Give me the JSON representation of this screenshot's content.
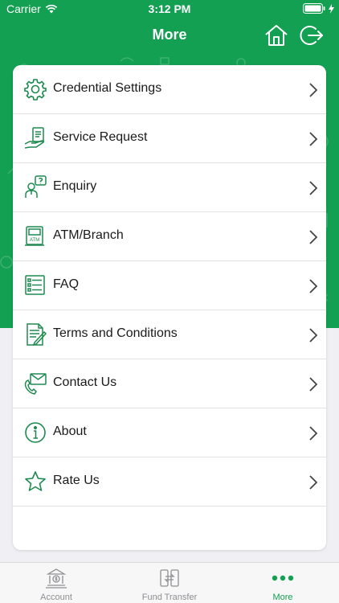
{
  "status_bar": {
    "carrier": "Carrier",
    "time": "3:12 PM"
  },
  "header": {
    "title": "More",
    "home_icon": "home-icon",
    "logout_icon": "logout-icon"
  },
  "colors": {
    "brand_green": "#13a052",
    "icon_green": "#1e8a50"
  },
  "menu": {
    "items": [
      {
        "label": "Credential Settings",
        "icon": "gear-icon"
      },
      {
        "label": "Service Request",
        "icon": "service-request-icon"
      },
      {
        "label": "Enquiry",
        "icon": "enquiry-icon"
      },
      {
        "label": "ATM/Branch",
        "icon": "atm-icon"
      },
      {
        "label": "FAQ",
        "icon": "faq-icon"
      },
      {
        "label": "Terms and Conditions",
        "icon": "document-icon"
      },
      {
        "label": "Contact Us",
        "icon": "contact-icon"
      },
      {
        "label": "About",
        "icon": "info-icon"
      },
      {
        "label": "Rate Us",
        "icon": "star-icon"
      }
    ],
    "atm_icon_text": "ATM"
  },
  "tab_bar": {
    "tabs": [
      {
        "label": "Account",
        "icon": "account-icon",
        "active": false
      },
      {
        "label": "Fund Transfer",
        "icon": "fund-transfer-icon",
        "active": false
      },
      {
        "label": "More",
        "icon": "more-dots-icon",
        "active": true
      }
    ]
  }
}
